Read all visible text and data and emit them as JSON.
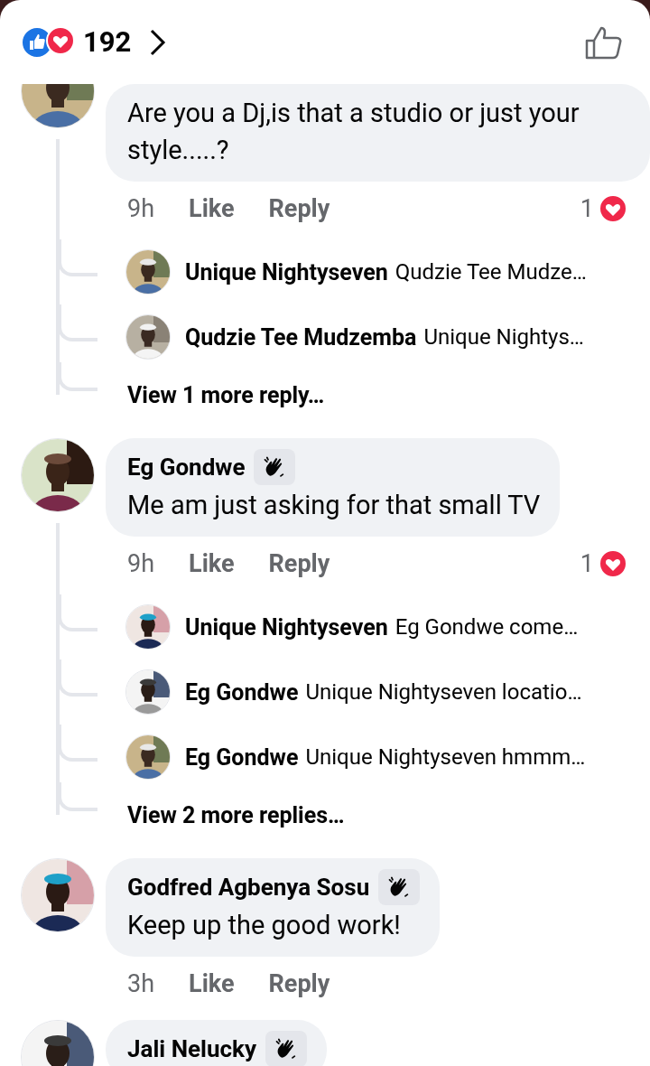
{
  "header": {
    "reaction_count": "192"
  },
  "comments": [
    {
      "text": "Are you a Dj,is that a studio or just your style.....?",
      "time": "9h",
      "actions": [
        "Like",
        "Reply"
      ],
      "reaction_count": "1",
      "replies": [
        {
          "author": "Unique Nightyseven",
          "text": "Qudzie Tee Mudze…"
        },
        {
          "author": "Qudzie Tee Mudzemba",
          "text": "Unique Nightys…"
        }
      ],
      "more": "View 1 more reply…"
    },
    {
      "author": "Eg Gondwe",
      "badge": true,
      "text": "Me am just asking for that small TV",
      "time": "9h",
      "actions": [
        "Like",
        "Reply"
      ],
      "reaction_count": "1",
      "replies": [
        {
          "author": "Unique Nightyseven",
          "text": "Eg Gondwe come…"
        },
        {
          "author": "Eg Gondwe",
          "text": "Unique Nightyseven locatio…"
        },
        {
          "author": "Eg Gondwe",
          "text": "Unique Nightyseven hmmm…"
        }
      ],
      "more": "View 2 more replies…"
    },
    {
      "author": "Godfred Agbenya Sosu",
      "badge": true,
      "text": "Keep up the good work!",
      "time": "3h",
      "actions": [
        "Like",
        "Reply"
      ]
    },
    {
      "author": "Jali Nelucky",
      "badge": true
    }
  ]
}
